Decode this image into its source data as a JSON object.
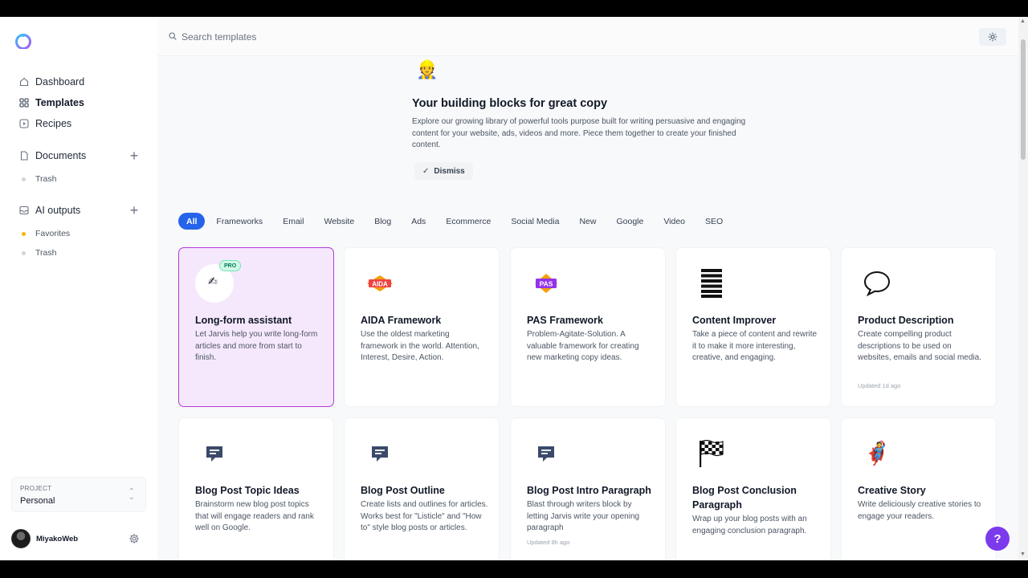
{
  "sidebar": {
    "nav": [
      {
        "label": "Dashboard",
        "icon": "home-icon"
      },
      {
        "label": "Templates",
        "icon": "grid-icon"
      },
      {
        "label": "Recipes",
        "icon": "play-box-icon"
      }
    ],
    "documents": {
      "label": "Documents",
      "trash": "Trash"
    },
    "ai_outputs": {
      "label": "AI outputs",
      "favorites": "Favorites",
      "trash": "Trash"
    },
    "project": {
      "label": "PROJECT",
      "value": "Personal"
    },
    "user": {
      "name": "MiyakoWeb"
    }
  },
  "search": {
    "placeholder": "Search templates"
  },
  "hero": {
    "emoji": "👷",
    "title": "Your building blocks for great copy",
    "description": "Explore our growing library of powerful tools purpose built for writing persuasive and engaging content for your website, ads, videos and more. Piece them together to create your finished content.",
    "dismiss": "Dismiss"
  },
  "filters": [
    "All",
    "Frameworks",
    "Email",
    "Website",
    "Blog",
    "Ads",
    "Ecommerce",
    "Social Media",
    "New",
    "Google",
    "Video",
    "SEO"
  ],
  "cards": [
    {
      "title": "Long-form assistant",
      "desc": "Let Jarvis help you write long-form articles and more from start to finish.",
      "badge": "PRO",
      "icon": "writing-hand-icon",
      "glyph": "✍"
    },
    {
      "title": "AIDA Framework",
      "desc": "Use the oldest marketing framework in the world. Attention, Interest, Desire, Action.",
      "icon": "aida-icon",
      "glyph": "AIDA"
    },
    {
      "title": "PAS Framework",
      "desc": "Problem-Agitate-Solution. A valuable framework for creating new marketing copy ideas.",
      "icon": "pas-icon",
      "glyph": "PAS"
    },
    {
      "title": "Content Improver",
      "desc": "Take a piece of content and rewrite it to make it more interesting, creative, and engaging.",
      "icon": "lines-icon"
    },
    {
      "title": "Product Description",
      "desc": "Create compelling product descriptions to be used on websites, emails and social media.",
      "icon": "speech-bubble-icon",
      "updated": "Updated 1d ago"
    },
    {
      "title": "Blog Post Topic Ideas",
      "desc": "Brainstorm new blog post topics that will engage readers and rank well on Google.",
      "icon": "message-icon"
    },
    {
      "title": "Blog Post Outline",
      "desc": "Create lists and outlines for articles. Works best for \"Listicle\" and \"How to\" style blog posts or articles.",
      "icon": "message-icon"
    },
    {
      "title": "Blog Post Intro Paragraph",
      "desc": "Blast through writers block by letting Jarvis write your opening paragraph",
      "icon": "message-icon",
      "updated": "Updated 8h ago"
    },
    {
      "title": "Blog Post Conclusion Paragraph",
      "desc": "Wrap up your blog posts with an engaging conclusion paragraph.",
      "icon": "checkered-flag-icon"
    },
    {
      "title": "Creative Story",
      "desc": "Write deliciously creative stories to engage your readers.",
      "icon": "superhero-icon",
      "glyph": "🦸"
    }
  ],
  "help": {
    "label": "?"
  },
  "colors": {
    "accent": "#2563eb",
    "selected_border": "#b33ad6",
    "selected_bg": "#f5e8fd",
    "help": "#7c3aed"
  }
}
